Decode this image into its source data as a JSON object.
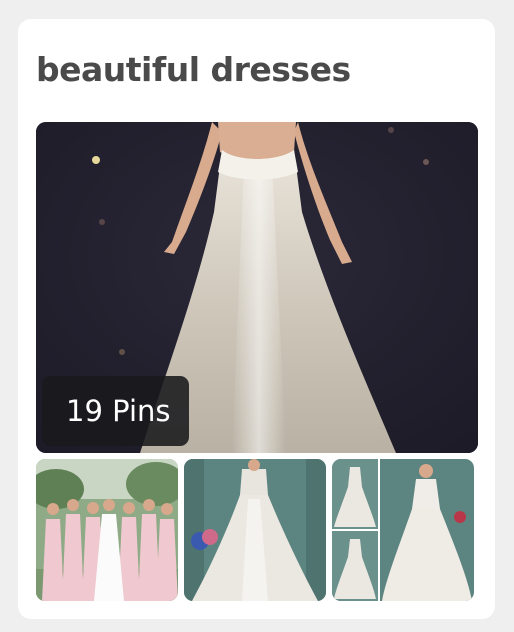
{
  "board": {
    "title": "beautiful dresses",
    "pin_count_label": "19 Pins"
  },
  "images": {
    "cover": "wedding dress back view on starry background",
    "thumb1": "bridesmaids in pink dresses",
    "thumb2": "white ball gown wedding dress",
    "thumb3": "lace wedding dress collage"
  }
}
